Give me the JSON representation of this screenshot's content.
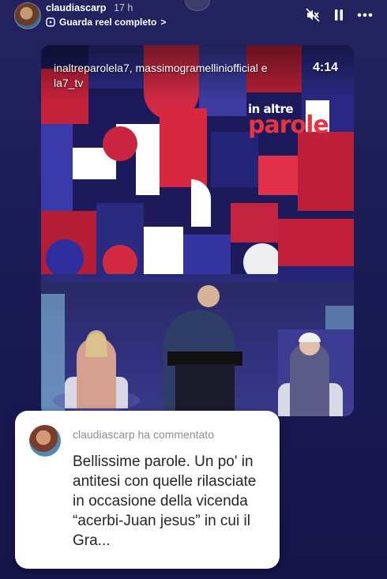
{
  "story": {
    "username": "claudiascarp",
    "time_ago": "17 h",
    "reel_link": "Guarda reel completo",
    "reel_link_chevron": ">",
    "controls": [
      "mute-icon",
      "pause-icon",
      "more-icon"
    ]
  },
  "reel": {
    "credits": "inaltreparolela7, massimogramelliniofficial e la7_tv",
    "duration": "4:14",
    "logo_line1": "in altre",
    "logo_line2": "parole"
  },
  "comment": {
    "header": "claudiascarp ha commentato",
    "text": "Bellissime parole. Un po' in antitesi con quelle rilasciate in occasione della vicenda “acerbi-Juan jesus” in cui il Gra..."
  },
  "colors": {
    "accent_red": "#e8343f",
    "background": "#1b1b55"
  }
}
